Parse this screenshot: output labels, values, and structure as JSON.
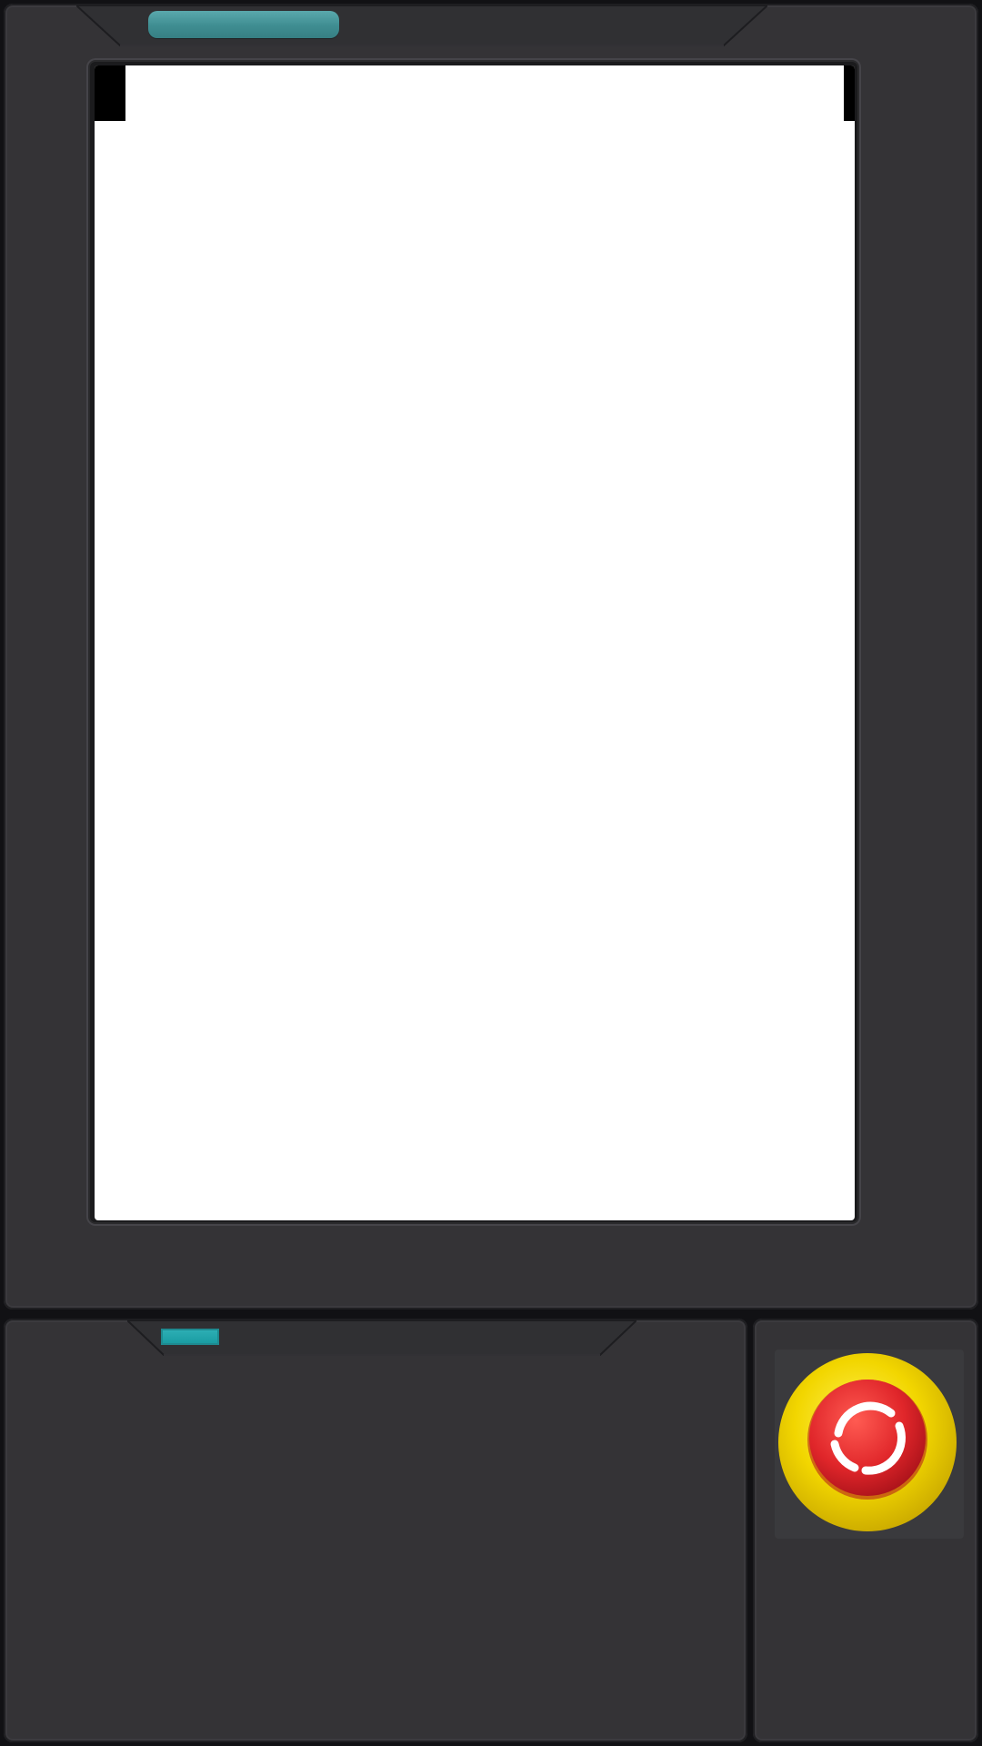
{
  "device": {
    "type": "industrial panel terminal",
    "screen": {
      "state": "blank",
      "color": "#ffffff"
    },
    "bezel_color": "#343336",
    "status_led": {
      "color": "#4a9ea3"
    },
    "indicator_led": {
      "color": "#1fa4aa"
    },
    "emergency_stop": {
      "icon": "emergency-stop-icon",
      "ring_color": "#f2d600",
      "button_color": "#e0262a",
      "arrow_color": "#ffffff"
    }
  }
}
